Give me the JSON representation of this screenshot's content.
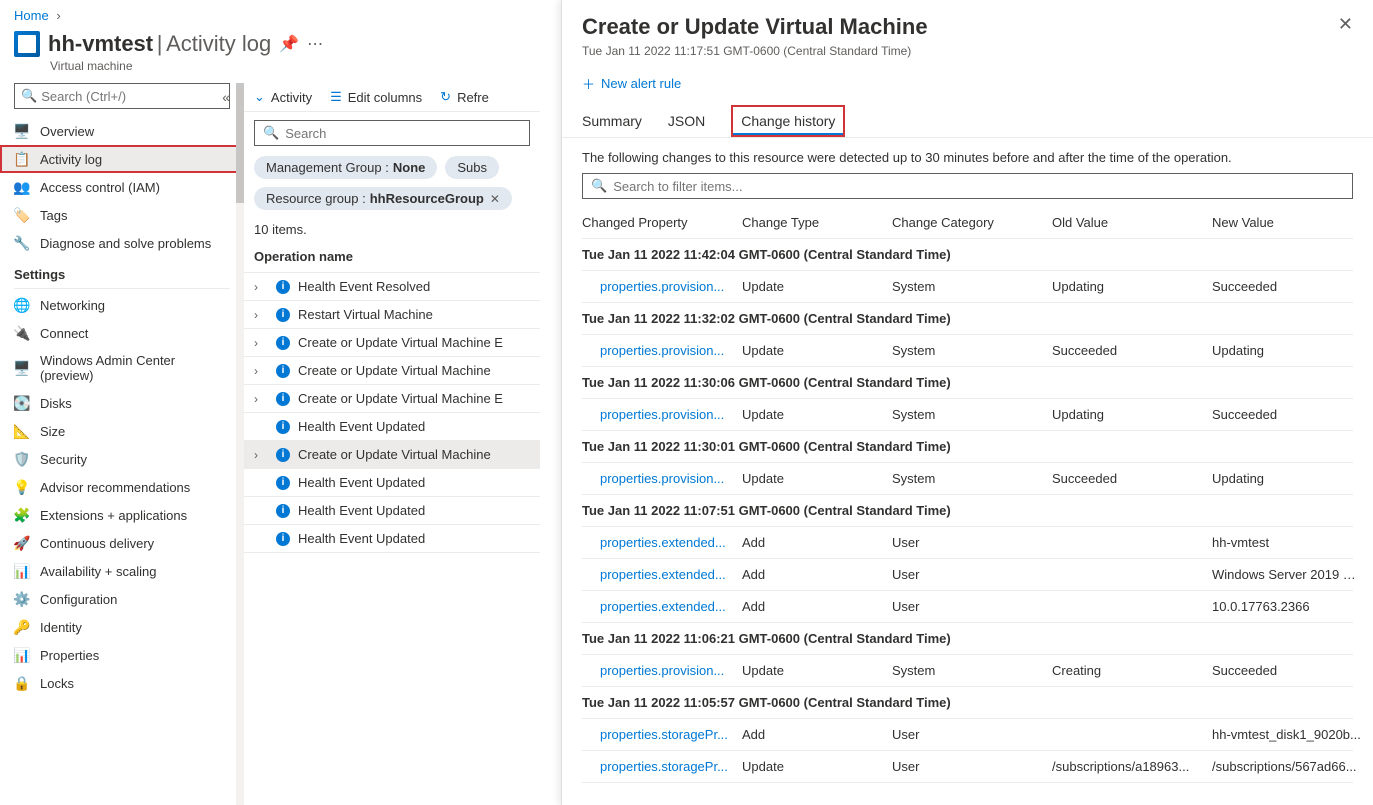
{
  "breadcrumb": {
    "home": "Home"
  },
  "header": {
    "resource_name": "hh-vmtest",
    "separator": "|",
    "page": "Activity log",
    "resource_type": "Virtual machine"
  },
  "sidebar": {
    "search_placeholder": "Search (Ctrl+/)",
    "items_top": [
      {
        "label": "Overview",
        "icon": "🖥️",
        "color": "#0078d4"
      },
      {
        "label": "Activity log",
        "icon": "📋",
        "color": "#0078d4",
        "active": true
      },
      {
        "label": "Access control (IAM)",
        "icon": "👥",
        "color": "#0078d4"
      },
      {
        "label": "Tags",
        "icon": "🏷️",
        "color": "#6b2fb3"
      },
      {
        "label": "Diagnose and solve problems",
        "icon": "🔧",
        "color": "#323130"
      }
    ],
    "settings_label": "Settings",
    "items_settings": [
      {
        "label": "Networking",
        "icon": "🌐",
        "color": "#0078d4"
      },
      {
        "label": "Connect",
        "icon": "🔌",
        "color": "#0078d4"
      },
      {
        "label": "Windows Admin Center (preview)",
        "icon": "🖥️",
        "color": "#323130"
      },
      {
        "label": "Disks",
        "icon": "💽",
        "color": "#107c10"
      },
      {
        "label": "Size",
        "icon": "📐",
        "color": "#0078d4"
      },
      {
        "label": "Security",
        "icon": "🛡️",
        "color": "#107c10"
      },
      {
        "label": "Advisor recommendations",
        "icon": "💡",
        "color": "#00b7c3"
      },
      {
        "label": "Extensions + applications",
        "icon": "🧩",
        "color": "#0078d4"
      },
      {
        "label": "Continuous delivery",
        "icon": "🚀",
        "color": "#0078d4"
      },
      {
        "label": "Availability + scaling",
        "icon": "📊",
        "color": "#0078d4"
      },
      {
        "label": "Configuration",
        "icon": "⚙️",
        "color": "#0078d4"
      },
      {
        "label": "Identity",
        "icon": "🔑",
        "color": "#ffb900"
      },
      {
        "label": "Properties",
        "icon": "📊",
        "color": "#0078d4"
      },
      {
        "label": "Locks",
        "icon": "🔒",
        "color": "#323130"
      }
    ]
  },
  "toolbar": {
    "activity": "Activity",
    "edit_columns": "Edit columns",
    "refresh": "Refre"
  },
  "activity": {
    "search_placeholder": "Search",
    "pills": [
      {
        "key": "Management Group",
        "value": "None"
      },
      {
        "key": "Subs",
        "value": ""
      },
      {
        "key": "Resource group",
        "value": "hhResourceGroup",
        "closable": true
      }
    ],
    "count": "10 items.",
    "header": "Operation name",
    "rows": [
      {
        "name": "Health Event Resolved",
        "expandable": true
      },
      {
        "name": "Restart Virtual Machine",
        "expandable": true
      },
      {
        "name": "Create or Update Virtual Machine E",
        "expandable": true
      },
      {
        "name": "Create or Update Virtual Machine",
        "expandable": true
      },
      {
        "name": "Create or Update Virtual Machine E",
        "expandable": true
      },
      {
        "name": "Health Event Updated",
        "expandable": false
      },
      {
        "name": "Create or Update Virtual Machine",
        "expandable": true,
        "selected": true
      },
      {
        "name": "Health Event Updated",
        "expandable": false
      },
      {
        "name": "Health Event Updated",
        "expandable": false
      },
      {
        "name": "Health Event Updated",
        "expandable": false
      }
    ]
  },
  "panel": {
    "title": "Create or Update Virtual Machine",
    "timestamp": "Tue Jan 11 2022 11:17:51 GMT-0600 (Central Standard Time)",
    "new_alert": "New alert rule",
    "tabs": [
      {
        "label": "Summary"
      },
      {
        "label": "JSON"
      },
      {
        "label": "Change history",
        "active": true,
        "highlighted": true
      }
    ],
    "description": "The following changes to this resource were detected up to 30 minutes before and after the time of the operation.",
    "filter_placeholder": "Search to filter items...",
    "columns": [
      "Changed Property",
      "Change Type",
      "Change Category",
      "Old Value",
      "New Value"
    ],
    "groups": [
      {
        "ts": "Tue Jan 11 2022 11:42:04 GMT-0600 (Central Standard Time)",
        "rows": [
          {
            "prop": "properties.provision...",
            "type": "Update",
            "cat": "System",
            "old": "Updating",
            "new": "Succeeded"
          }
        ]
      },
      {
        "ts": "Tue Jan 11 2022 11:32:02 GMT-0600 (Central Standard Time)",
        "rows": [
          {
            "prop": "properties.provision...",
            "type": "Update",
            "cat": "System",
            "old": "Succeeded",
            "new": "Updating"
          }
        ]
      },
      {
        "ts": "Tue Jan 11 2022 11:30:06 GMT-0600 (Central Standard Time)",
        "rows": [
          {
            "prop": "properties.provision...",
            "type": "Update",
            "cat": "System",
            "old": "Updating",
            "new": "Succeeded"
          }
        ]
      },
      {
        "ts": "Tue Jan 11 2022 11:30:01 GMT-0600 (Central Standard Time)",
        "rows": [
          {
            "prop": "properties.provision...",
            "type": "Update",
            "cat": "System",
            "old": "Succeeded",
            "new": "Updating"
          }
        ]
      },
      {
        "ts": "Tue Jan 11 2022 11:07:51 GMT-0600 (Central Standard Time)",
        "rows": [
          {
            "prop": "properties.extended...",
            "type": "Add",
            "cat": "User",
            "old": "",
            "new": "hh-vmtest"
          },
          {
            "prop": "properties.extended...",
            "type": "Add",
            "cat": "User",
            "old": "",
            "new": "Windows Server 2019 D..."
          },
          {
            "prop": "properties.extended...",
            "type": "Add",
            "cat": "User",
            "old": "",
            "new": "10.0.17763.2366"
          }
        ]
      },
      {
        "ts": "Tue Jan 11 2022 11:06:21 GMT-0600 (Central Standard Time)",
        "rows": [
          {
            "prop": "properties.provision...",
            "type": "Update",
            "cat": "System",
            "old": "Creating",
            "new": "Succeeded"
          }
        ]
      },
      {
        "ts": "Tue Jan 11 2022 11:05:57 GMT-0600 (Central Standard Time)",
        "rows": [
          {
            "prop": "properties.storagePr...",
            "type": "Add",
            "cat": "User",
            "old": "",
            "new": "hh-vmtest_disk1_9020b..."
          },
          {
            "prop": "properties.storagePr...",
            "type": "Update",
            "cat": "User",
            "old": "/subscriptions/a18963...",
            "new": "/subscriptions/567ad66..."
          }
        ]
      }
    ]
  }
}
